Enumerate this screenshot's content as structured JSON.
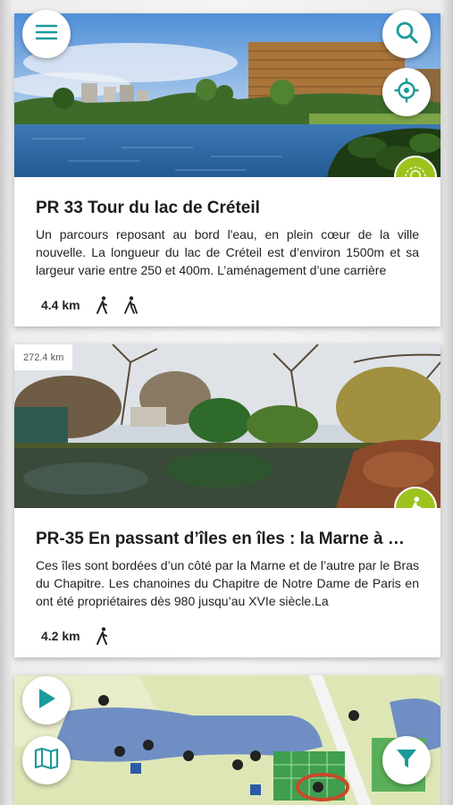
{
  "colors": {
    "accent": "#1a9a9a",
    "badge": "#9dc31f"
  },
  "cards": [
    {
      "distance_tag": "",
      "title": "PR 33 Tour du lac de Créteil",
      "description": "Un parcours reposant au bord l'eau, en plein cœur de la ville nouvelle. La longueur du lac de Créteil est d’environ 1500m et sa largeur varie entre 250 et 400m. L’aménagement d’une carrière",
      "distance": "4.4 km",
      "badge_icon": "lightbulb-icon",
      "activity_icons": [
        "hiking-icon",
        "nordic-walking-icon"
      ]
    },
    {
      "distance_tag": "272.4 km",
      "title": "PR-35 En passant d’îles en îles : la Marne à …",
      "description": "Ces îles sont bordées d’un côté par la Marne et de l’autre par le Bras du Chapitre. Les chanoines du Chapitre de Notre Dame de Paris en ont été propriétaires dès 980 jusqu’au XVIe siècle.La",
      "distance": "4.2 km",
      "badge_icon": "hiking-icon",
      "activity_icons": [
        "hiking-icon"
      ]
    }
  ],
  "fabs": [
    "menu-icon",
    "search-icon",
    "locate-icon",
    "play-icon",
    "map-icon",
    "filter-icon"
  ]
}
